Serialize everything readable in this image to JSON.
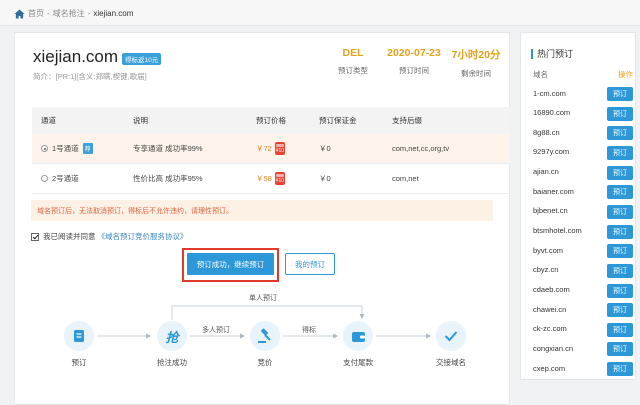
{
  "breadcrumb": {
    "home": "首页",
    "sep1": "-",
    "section": "域名抢注",
    "sep2": "-",
    "current": "xiejian.com"
  },
  "domain": {
    "name": "xiejian.com",
    "badge": "得标返10元",
    "intro": "简介：[PR:1][含义:郑瞒,楔键,歌届]"
  },
  "stats": [
    {
      "value": "DEL",
      "label": "预订类型"
    },
    {
      "value": "2020-07-23",
      "label": "预订时间"
    },
    {
      "value": "7小时20分",
      "label": "剩余时间"
    }
  ],
  "table": {
    "headers": [
      "通道",
      "说明",
      "预订价格",
      "预订保证金",
      "支持后缀"
    ],
    "rows": [
      {
        "channel": "1号通道",
        "recommend": "荐",
        "desc": "专享通道 成功率99%",
        "price": "￥72",
        "deposit": "￥0",
        "suffix": "com,net,cc,org,tv",
        "selected": true
      },
      {
        "channel": "2号通道",
        "recommend": "",
        "desc": "性价比高 成功率95%",
        "price": "￥58",
        "deposit": "￥0",
        "suffix": "com,net",
        "selected": false
      }
    ]
  },
  "notice": "域名预订后，无法取消预订，得标后不允许违约，请理性预订。",
  "agree": {
    "text": "我已阅读并同意",
    "link": "《域名预订竞价服务协议》"
  },
  "buttons": {
    "primary": "预订成功，继续预订",
    "secondary": "我的预订"
  },
  "flow": {
    "steps": [
      "预订",
      "抢注成功",
      "竞价",
      "支付尾款",
      "交接域名"
    ],
    "arrows": {
      "single": "单人预订",
      "multi": "多人预订",
      "win": "得标"
    },
    "step2_glyph": "抢"
  },
  "sidebar": {
    "title": "热门预订",
    "col_domain": "域名",
    "col_op": "操作",
    "button": "预订",
    "items": [
      "1-cm.com",
      "16890.com",
      "8g88.cn",
      "9297y.com",
      "ajian.cn",
      "baianer.com",
      "bjbenet.cn",
      "btsmhotel.com",
      "byvt.com",
      "cbyz.cn",
      "cdaeb.com",
      "chawei.cn",
      "ck-zc.com",
      "congxian.cn",
      "cxep.com"
    ]
  },
  "colors": {
    "accent": "#2d98d8",
    "gold": "#e6a11c",
    "price": "#e7821f",
    "warn_bg": "#fdf1e6",
    "highlight": "#e23a2a"
  }
}
